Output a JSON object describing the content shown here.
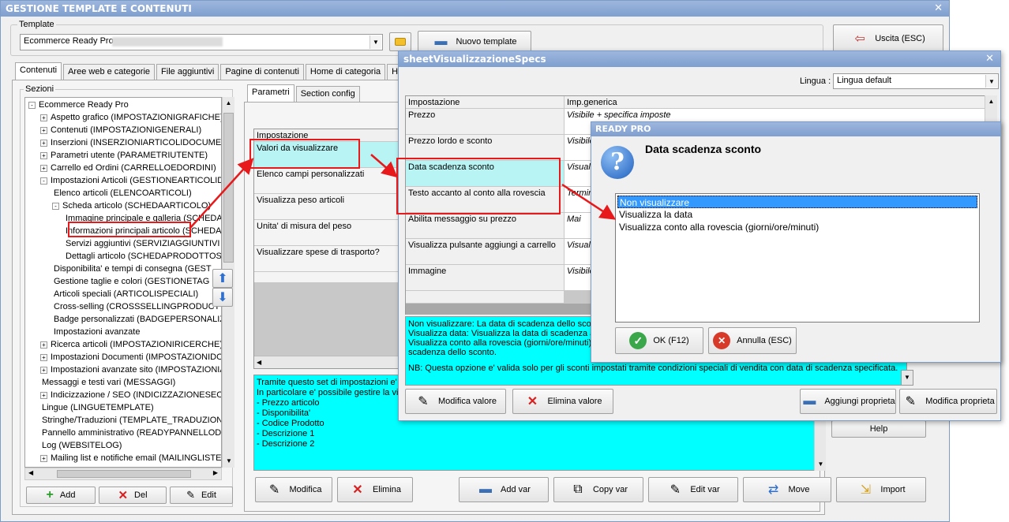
{
  "main_window": {
    "title": "GESTIONE TEMPLATE E CONTENUTI",
    "template_group_label": "Template",
    "template_value": "Ecommerce Ready Pro",
    "nuovo_template": "Nuovo template",
    "uscita": "Uscita (ESC)",
    "tabs": [
      "Contenuti",
      "Aree web e categorie",
      "File aggiuntivi",
      "Pagine di contenuti",
      "Home di categoria",
      "Hom"
    ],
    "sezioni_label": "Sezioni",
    "tree": [
      {
        "label": "Ecommerce Ready Pro",
        "exp": "-",
        "indent": 0
      },
      {
        "label": "Aspetto grafico (IMPOSTAZIONIGRAFICHE)",
        "exp": "+",
        "indent": 1
      },
      {
        "label": "Contenuti (IMPOSTAZIONIGENERALI)",
        "exp": "+",
        "indent": 1
      },
      {
        "label": "Inserzioni (INSERZIONIARTICOLIDOCUMENT",
        "exp": "+",
        "indent": 1
      },
      {
        "label": "Parametri utente (PARAMETRIUTENTE)",
        "exp": "+",
        "indent": 1
      },
      {
        "label": "Carrello ed Ordini (CARRELLOEDORDINI)",
        "exp": "+",
        "indent": 1
      },
      {
        "label": "Impostazioni Articoli (GESTIONEARTICOLIDO",
        "exp": "-",
        "indent": 1
      },
      {
        "label": "Elenco articoli (ELENCOARTICOLI)",
        "exp": "",
        "indent": 2
      },
      {
        "label": "Scheda articolo (SCHEDAARTICOLO)",
        "exp": "-",
        "indent": 2
      },
      {
        "label": "Immagine principale e galleria (SCHEDA",
        "exp": "",
        "indent": 3
      },
      {
        "label": "Informazioni principali articolo (SCHEDA",
        "exp": "",
        "indent": 3
      },
      {
        "label": "Servizi aggiuntivi (SERVIZIAGGIUNTIVI",
        "exp": "",
        "indent": 3
      },
      {
        "label": "Dettagli articolo (SCHEDAPRODOTTOSI",
        "exp": "",
        "indent": 3
      },
      {
        "label": "Disponibilita' e tempi di consegna (GEST",
        "exp": "",
        "indent": 2
      },
      {
        "label": "Gestione taglie e colori (GESTIONETAG",
        "exp": "",
        "indent": 2
      },
      {
        "label": "Articoli speciali (ARTICOLISPECIALI)",
        "exp": "",
        "indent": 2
      },
      {
        "label": "Cross-selling (CROSSSELLINGPRODUCT",
        "exp": "",
        "indent": 2
      },
      {
        "label": "Badge personalizzati (BADGEPERSONALIZ",
        "exp": "",
        "indent": 2
      },
      {
        "label": "Impostazioni avanzate",
        "exp": "",
        "indent": 2
      },
      {
        "label": "Ricerca articoli (IMPOSTAZIONIRICERCHE)",
        "exp": "+",
        "indent": 1
      },
      {
        "label": "Impostazioni Documenti (IMPOSTAZIONIDOC",
        "exp": "+",
        "indent": 1
      },
      {
        "label": "Impostazioni avanzate sito (IMPOSTAZIONIA",
        "exp": "+",
        "indent": 1
      },
      {
        "label": "Messaggi e testi vari (MESSAGGI)",
        "exp": "",
        "indent": 1
      },
      {
        "label": "Indicizzazione / SEO (INDICIZZAZIONESEO)",
        "exp": "+",
        "indent": 1
      },
      {
        "label": "Lingue (LINGUETEMPLATE)",
        "exp": "",
        "indent": 1
      },
      {
        "label": "Stringhe/Traduzioni (TEMPLATE_TRADUZION",
        "exp": "",
        "indent": 1
      },
      {
        "label": "Pannello amministrativo (READYPANNELLODIA",
        "exp": "",
        "indent": 1
      },
      {
        "label": "Log (WEBSITELOG)",
        "exp": "",
        "indent": 1
      },
      {
        "label": "Mailing list e notifiche email (MAILINGLISTENC",
        "exp": "+",
        "indent": 1
      }
    ],
    "tree_buttons": {
      "add": "Add",
      "del": "Del",
      "edit": "Edit"
    },
    "sub_tabs": [
      "Parametri",
      "Section config"
    ],
    "param_header": "Impostazione",
    "params": [
      "Valori da visualizzare",
      "Elenco campi personalizzati",
      "Visualizza peso articoli",
      "Unita' di misura del peso",
      "Visualizzare spese di trasporto?"
    ],
    "description_lines": [
      "Tramite questo set di impostazioni e' p",
      "In particolare e' possibile gestire la visi",
      "- Prezzo articolo",
      "- Disponibilita'",
      "- Codice Prodotto",
      "- Descrizione 1",
      "- Descrizione 2"
    ],
    "bottom_buttons": {
      "modifica": "Modifica",
      "elimina": "Elimina",
      "add_var": "Add var",
      "copy_var": "Copy var",
      "edit_var": "Edit var",
      "move": "Move",
      "import": "Import"
    },
    "help": "Help"
  },
  "specs_window": {
    "title": "sheetVisualizzazioneSpecs",
    "lingua_label": "Lingua :",
    "lingua_value": "Lingua default",
    "col_impostazione": "Impostazione",
    "col_imp_generica": "Imp.generica",
    "rows": [
      {
        "name": "Prezzo",
        "value": "Visibile + specifica imposte"
      },
      {
        "name": "Prezzo lordo e sconto",
        "value": "Visibile"
      },
      {
        "name": "Data scadenza sconto",
        "value": "Visuali"
      },
      {
        "name": "Testo accanto al conto alla rovescia",
        "value": "Termin"
      },
      {
        "name": "Abilita messaggio su prezzo",
        "value": "Mai"
      },
      {
        "name": "Visualizza pulsante aggiungi a carrello",
        "value": "Visuali"
      },
      {
        "name": "Immagine",
        "value": "Visibile"
      }
    ],
    "info_lines": [
      "Non visualizzare: La data di scadenza dello sconto",
      "Visualizza data: Visualizza la data di scadenza ac",
      "Visualizza conto alla rovescia (giorni/ore/minuti):",
      "scadenza dello sconto."
    ],
    "info_note": "NB: Questa opzione e' valida solo per gli sconti impostati tramite condizioni speciali di vendita con data di scadenza specificata.",
    "buttons": {
      "modifica_valore": "Modifica valore",
      "elimina_valore": "Elimina valore",
      "aggiungi_proprieta": "Aggiungi proprieta",
      "modifica_proprieta": "Modifica proprieta"
    }
  },
  "dialog": {
    "title": "READY PRO",
    "heading": "Data scadenza sconto",
    "options": [
      "Non visualizzare",
      "Visualizza la data",
      "Visualizza conto alla rovescia (giorni/ore/minuti)"
    ],
    "selected_index": 0,
    "ok": "OK (F12)",
    "annulla": "Annulla (ESC)"
  },
  "colors": {
    "accent": "#3399ff",
    "highlight_red": "#e8191b",
    "cyan": "#00ffff",
    "titlebar": "#8aa8d4"
  }
}
